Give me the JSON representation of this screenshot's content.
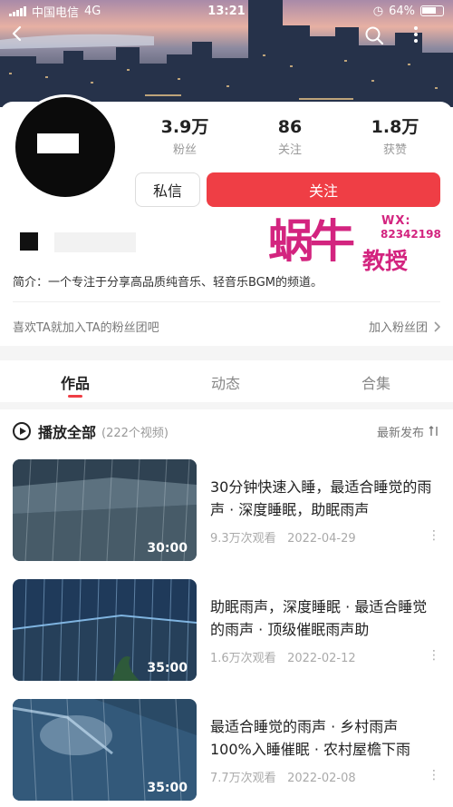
{
  "status_bar": {
    "carrier": "中国电信",
    "network": "4G",
    "time": "13:21",
    "battery": "64%"
  },
  "profile": {
    "stats": [
      {
        "value": "3.9万",
        "label": "粉丝"
      },
      {
        "value": "86",
        "label": "关注"
      },
      {
        "value": "1.8万",
        "label": "获赞"
      }
    ],
    "message_label": "私信",
    "follow_label": "关注",
    "bio": "简介：一个专注于分享高品质纯音乐、轻音乐BGM的频道。",
    "fans_group_text": "喜欢TA就加入TA的粉丝团吧",
    "fans_group_join": "加入粉丝团"
  },
  "watermark": {
    "big": "蜗牛",
    "small": "教授",
    "wx": "WX:",
    "number": "82342198"
  },
  "tabs": [
    {
      "label": "作品",
      "active": true
    },
    {
      "label": "动态",
      "active": false
    },
    {
      "label": "合集",
      "active": false
    }
  ],
  "playlist": {
    "play_all": "播放全部",
    "count": "(222个视频)",
    "sort": "最新发布"
  },
  "videos": [
    {
      "title": "30分钟快速入睡，最适合睡觉的雨声 · 深度睡眠，助眠雨声",
      "duration": "30:00",
      "views": "9.3万次观看",
      "date": "2022-04-29"
    },
    {
      "title": "助眠雨声，深度睡眠 · 最适合睡觉的雨声 · 顶级催眠雨声助",
      "duration": "35:00",
      "views": "1.6万次观看",
      "date": "2022-02-12"
    },
    {
      "title": "最适合睡觉的雨声 · 乡村雨声100%入睡催眠 · 农村屋檐下雨",
      "duration": "35:00",
      "views": "7.7万次观看",
      "date": "2022-02-08"
    }
  ],
  "colors": {
    "accent": "#ef3e45",
    "watermark": "#d3247f"
  },
  "icons": [
    "back-arrow-icon",
    "search-icon",
    "more-vertical-icon",
    "play-circle-icon",
    "sort-icon",
    "chevron-right-icon"
  ]
}
